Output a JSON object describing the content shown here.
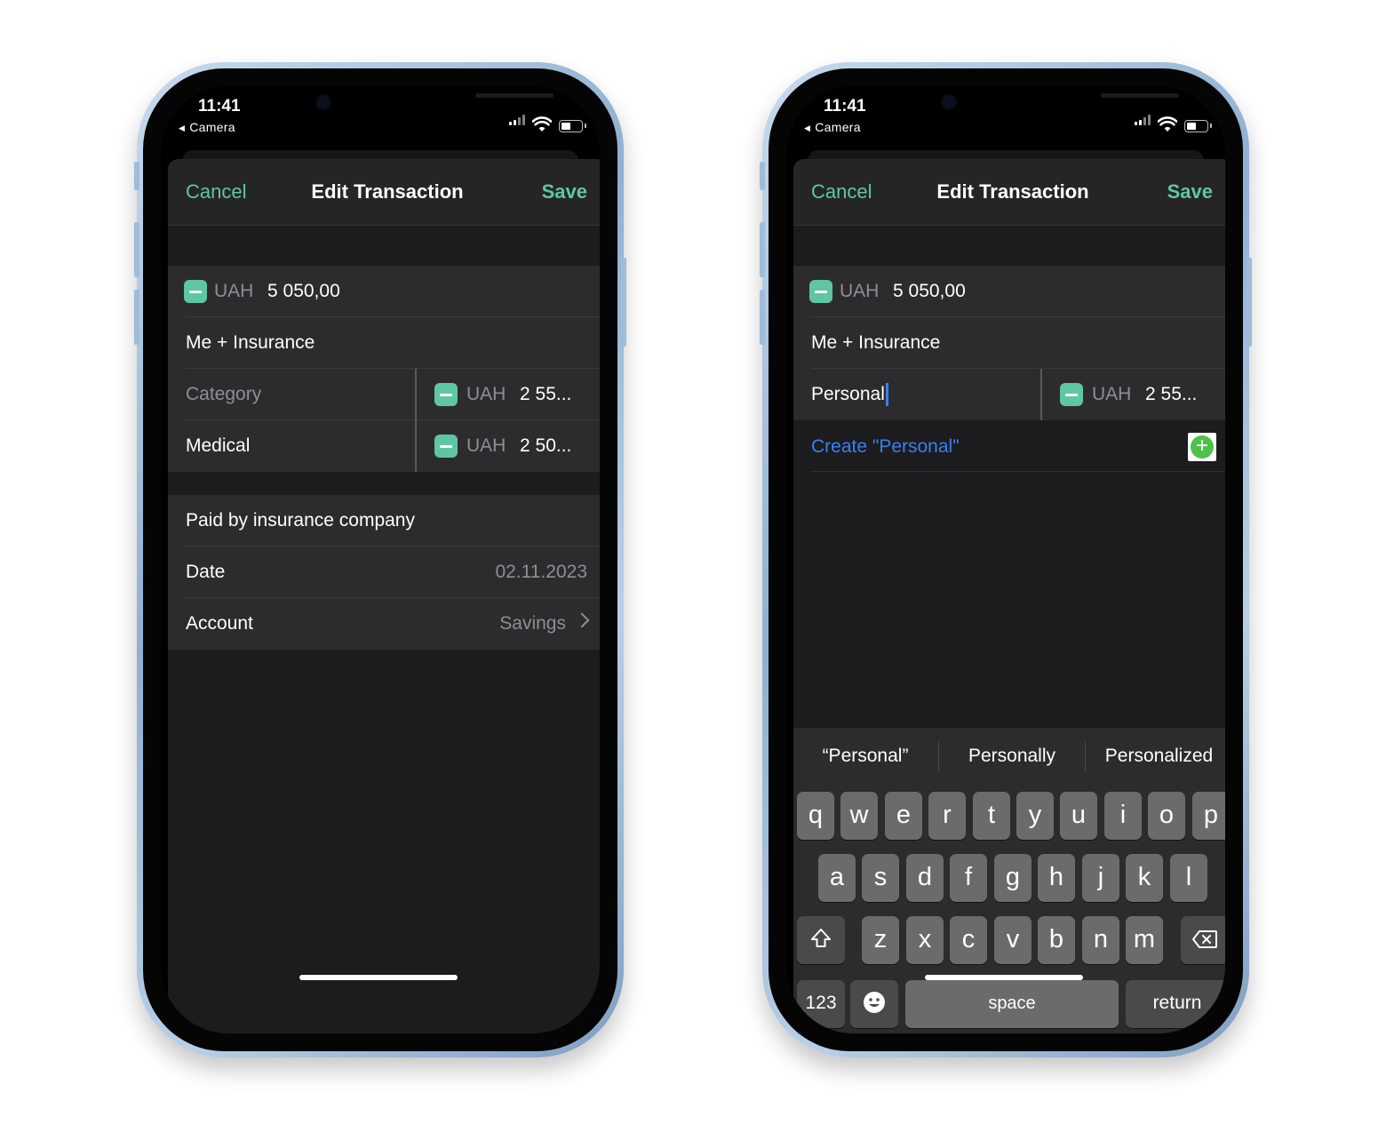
{
  "status": {
    "time": "11:41",
    "back_label": "Camera"
  },
  "left": {
    "nav": {
      "cancel": "Cancel",
      "title": "Edit Transaction",
      "save": "Save"
    },
    "amount": {
      "currency": "UAH",
      "value": "5 050,00"
    },
    "payee": "Me + Insurance",
    "splits": [
      {
        "category": "Category",
        "currency": "UAH",
        "amount": "2 55..."
      },
      {
        "category": "Medical",
        "currency": "UAH",
        "amount": "2 50..."
      }
    ],
    "note": "Paid by insurance company",
    "date": {
      "label": "Date",
      "value": "02.11.2023"
    },
    "account": {
      "label": "Account",
      "value": "Savings"
    }
  },
  "right": {
    "nav": {
      "cancel": "Cancel",
      "title": "Edit Transaction",
      "save": "Save"
    },
    "amount": {
      "currency": "UAH",
      "value": "5 050,00"
    },
    "payee": "Me + Insurance",
    "split": {
      "category_input": "Personal",
      "currency": "UAH",
      "amount": "2 55..."
    },
    "create_label": "Create \"Personal\"",
    "keyboard": {
      "suggestions": [
        "“Personal”",
        "Personally",
        "Personalized"
      ],
      "row1": [
        "q",
        "w",
        "e",
        "r",
        "t",
        "y",
        "u",
        "i",
        "o",
        "p"
      ],
      "row2": [
        "a",
        "s",
        "d",
        "f",
        "g",
        "h",
        "j",
        "k",
        "l"
      ],
      "row3": [
        "z",
        "x",
        "c",
        "v",
        "b",
        "n",
        "m"
      ],
      "numbers_key": "123",
      "space_key": "space",
      "return_key": "return"
    }
  },
  "colors": {
    "accent": "#5fc6a3",
    "link": "#3a7ff2",
    "sheet": "#1c1c1e",
    "cell": "#2c2c2e"
  },
  "icons": [
    "shift-icon",
    "delete-icon",
    "emoji-icon",
    "globe-icon",
    "microphone-icon",
    "chevron-right-icon",
    "minus-icon",
    "plus-circle-icon",
    "signal-icon",
    "wifi-icon",
    "battery-icon"
  ]
}
